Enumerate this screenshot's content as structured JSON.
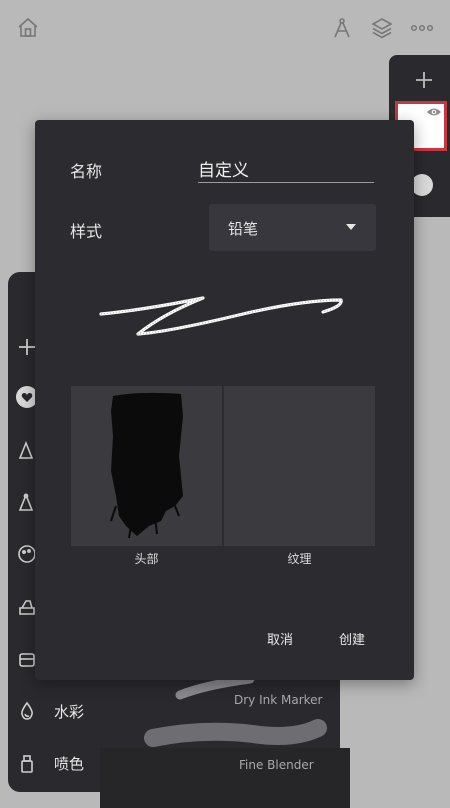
{
  "toolbar": {
    "icons": [
      "home-icon",
      "compass-icon",
      "layers-icon",
      "more-icon"
    ]
  },
  "brush_library": {
    "categories": [
      {
        "icon": "water-drop-icon",
        "label": "水彩"
      },
      {
        "icon": "spray-can-icon",
        "label": "喷色"
      }
    ],
    "brushes": [
      {
        "label": "Dry Ink Marker"
      },
      {
        "label": "Fine Blender"
      }
    ]
  },
  "dialog": {
    "name_label": "名称",
    "name_value": "自定义",
    "style_label": "样式",
    "style_value": "铅笔",
    "head_label": "头部",
    "texture_label": "纹理",
    "cancel_label": "取消",
    "create_label": "创建"
  },
  "colors": {
    "dialog_bg": "#2b2b30",
    "backdrop": "#b9b9b9",
    "selected_layer_border": "#c8373f"
  }
}
